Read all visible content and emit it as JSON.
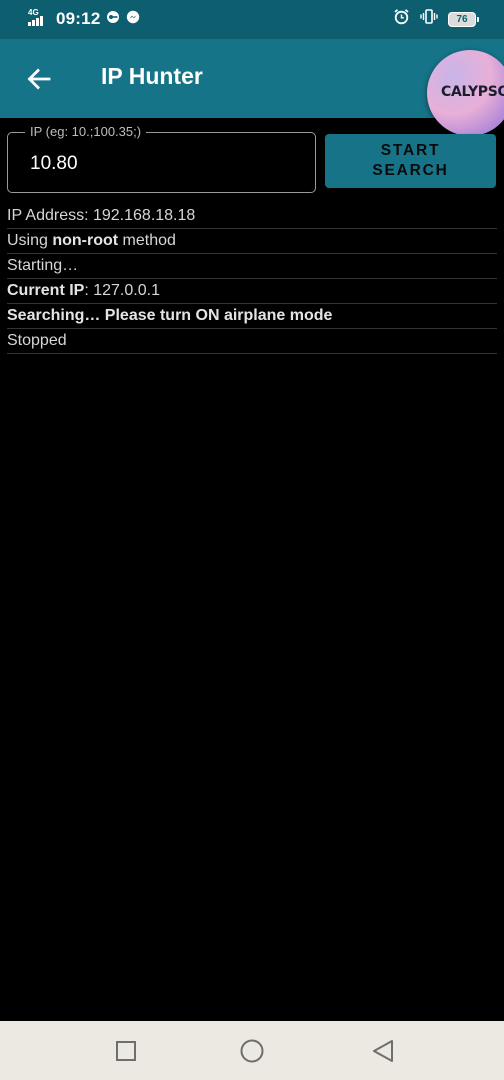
{
  "status_bar": {
    "network": "4G",
    "time": "09:12",
    "battery_level": "76",
    "icons": [
      "signal-icon",
      "vpn-key-icon",
      "messenger-icon",
      "alarm-icon",
      "vibrate-icon",
      "battery-icon"
    ]
  },
  "app_bar": {
    "title": "IP Hunter",
    "back_icon": "arrow-left-icon"
  },
  "overlay": {
    "label": "CALYPSO"
  },
  "search": {
    "label": "IP (eg: 10.;100.35;)",
    "value": "10.80",
    "button_line1": "START",
    "button_line2": "SEARCH"
  },
  "log": {
    "ip_address": "IP Address: 192.168.18.18",
    "method_prefix": "Using ",
    "method_bold": "non-root",
    "method_suffix": " method",
    "starting": "Starting…",
    "current_ip_label": "Current IP",
    "current_ip_value": ": 127.0.0.1",
    "searching": "Searching… Please turn ON airplane mode",
    "stopped": "Stopped"
  },
  "nav_bar": {
    "icons": [
      "recents-square-icon",
      "home-circle-icon",
      "back-triangle-icon"
    ]
  },
  "colors": {
    "status_bar_bg": "#0d5f70",
    "app_bar_bg": "#167489",
    "button_bg": "#177488",
    "background": "#000000",
    "nav_bar_bg": "#ece8e2"
  }
}
